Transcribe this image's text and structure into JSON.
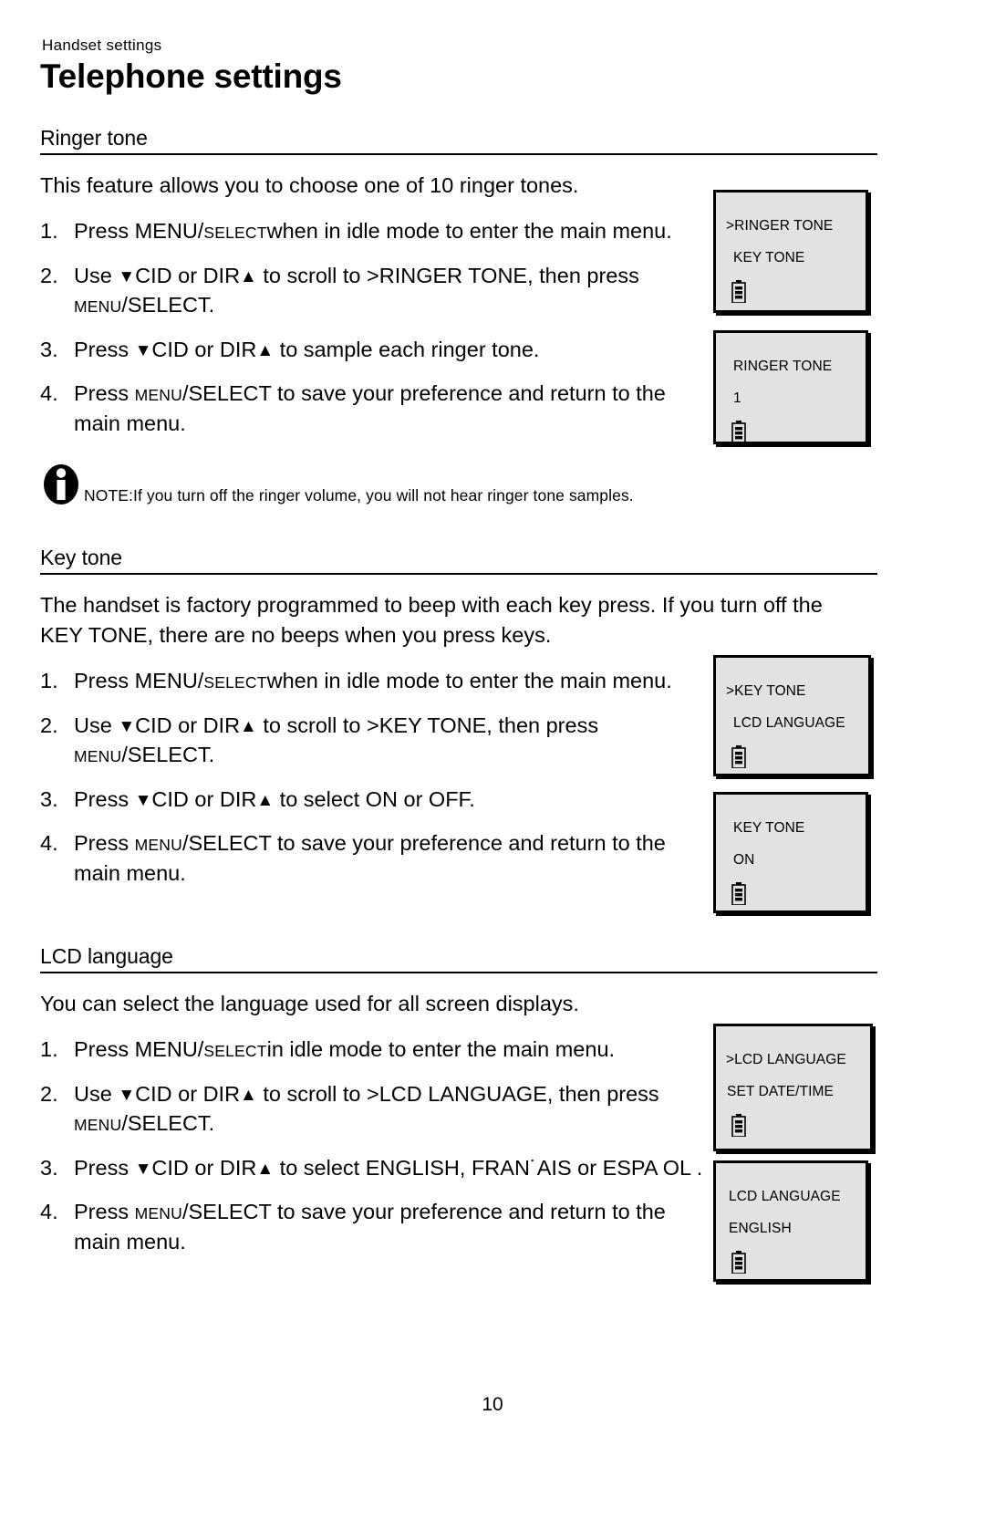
{
  "header": {
    "running_head": "Handset settings",
    "title": "Telephone settings"
  },
  "sections": [
    {
      "id": "ringer-tone",
      "heading": "Ringer tone",
      "intro": "This feature allows you to choose one of 10 ringer tones.",
      "steps": [
        {
          "num": "1.",
          "parts": [
            {
              "t": "Press MENU/",
              "style": "normal"
            },
            {
              "t": "SELECT",
              "style": "smallcaps"
            },
            {
              "t": "when in idle mode to enter the main menu.",
              "style": "normal"
            }
          ]
        },
        {
          "num": "2.",
          "parts": [
            {
              "t": "Use ",
              "style": "normal"
            },
            {
              "t": "▼",
              "style": "arrow"
            },
            {
              "t": "CID or DIR",
              "style": "normal"
            },
            {
              "t": "▲",
              "style": "arrow"
            },
            {
              "t": " to scroll to >RINGER TONE, then press ",
              "style": "normal"
            },
            {
              "t": "MENU",
              "style": "smallcaps"
            },
            {
              "t": "/SELECT.",
              "style": "normal"
            }
          ]
        },
        {
          "num": "3.",
          "parts": [
            {
              "t": "Press ",
              "style": "normal"
            },
            {
              "t": "▼",
              "style": "arrow"
            },
            {
              "t": "CID or DIR",
              "style": "normal"
            },
            {
              "t": "▲",
              "style": "arrow"
            },
            {
              "t": " to sample each ringer tone.",
              "style": "normal"
            }
          ]
        },
        {
          "num": "4.",
          "parts": [
            {
              "t": "Press ",
              "style": "normal"
            },
            {
              "t": "MENU",
              "style": "smallcaps"
            },
            {
              "t": "/SELECT",
              "style": "normal"
            },
            {
              "t": " to save your preference and return to the main menu.",
              "style": "normal"
            }
          ]
        }
      ]
    },
    {
      "id": "key-tone",
      "heading": "Key tone",
      "intro": "The handset is factory programmed to beep with each key press. If you turn off the KEY TONE, there are no beeps when you press keys.",
      "steps": [
        {
          "num": "1.",
          "parts": [
            {
              "t": "Press MENU/",
              "style": "normal"
            },
            {
              "t": "SELECT",
              "style": "smallcaps"
            },
            {
              "t": "when in idle mode to enter the main menu.",
              "style": "normal"
            }
          ]
        },
        {
          "num": "2.",
          "parts": [
            {
              "t": "Use ",
              "style": "normal"
            },
            {
              "t": "▼",
              "style": "arrow"
            },
            {
              "t": "CID or DIR",
              "style": "normal"
            },
            {
              "t": "▲",
              "style": "arrow"
            },
            {
              "t": " to scroll to >KEY TONE, then press ",
              "style": "normal"
            },
            {
              "t": "MENU",
              "style": "smallcaps"
            },
            {
              "t": "/SELECT.",
              "style": "normal"
            }
          ]
        },
        {
          "num": "3.",
          "parts": [
            {
              "t": "Press ",
              "style": "normal"
            },
            {
              "t": "▼",
              "style": "arrow"
            },
            {
              "t": "CID or DIR",
              "style": "normal"
            },
            {
              "t": "▲",
              "style": "arrow"
            },
            {
              "t": " to select ON or OFF.",
              "style": "normal"
            }
          ]
        },
        {
          "num": "4.",
          "parts": [
            {
              "t": "Press ",
              "style": "normal"
            },
            {
              "t": "MENU",
              "style": "smallcaps"
            },
            {
              "t": "/SELECT",
              "style": "normal"
            },
            {
              "t": " to save your preference and return to the main menu.",
              "style": "normal"
            }
          ]
        }
      ]
    },
    {
      "id": "lcd-language",
      "heading": "LCD language",
      "intro": "You can select the language used for all screen displays.",
      "steps": [
        {
          "num": "1.",
          "parts": [
            {
              "t": "Press MENU/",
              "style": "normal"
            },
            {
              "t": "SELECT",
              "style": "smallcaps"
            },
            {
              "t": "in idle mode to enter the main menu.",
              "style": "normal"
            }
          ]
        },
        {
          "num": "2.",
          "parts": [
            {
              "t": "Use ",
              "style": "normal"
            },
            {
              "t": "▼",
              "style": "arrow"
            },
            {
              "t": "CID or DIR",
              "style": "normal"
            },
            {
              "t": "▲",
              "style": "arrow"
            },
            {
              "t": " to scroll to >LCD LANGUAGE, then press ",
              "style": "normal"
            },
            {
              "t": "MENU",
              "style": "smallcaps"
            },
            {
              "t": "/SELECT.",
              "style": "normal"
            }
          ]
        },
        {
          "num": "3.",
          "parts": [
            {
              "t": "Press ",
              "style": "normal"
            },
            {
              "t": "▼",
              "style": "arrow"
            },
            {
              "t": "CID or DIR",
              "style": "normal"
            },
            {
              "t": "▲",
              "style": "arrow"
            },
            {
              "t": " to select ENGLISH, FRAN˙AIS  or ESPA OL .",
              "style": "normal"
            }
          ]
        },
        {
          "num": "4.",
          "parts": [
            {
              "t": "Press ",
              "style": "normal"
            },
            {
              "t": "MENU",
              "style": "smallcaps"
            },
            {
              "t": "/SELECT",
              "style": "normal"
            },
            {
              "t": " to save your preference and return to the main menu.",
              "style": "normal"
            }
          ]
        }
      ]
    }
  ],
  "note": {
    "icon": "info-icon",
    "label": "NOTE:",
    "text": "If you turn off the ringer volume, you will not hear ringer tone samples."
  },
  "lcd_screens": [
    {
      "id": "ringer-tone-menu",
      "line1": ">RINGER TONE",
      "line2": "KEY TONE",
      "battery": "battery-icon"
    },
    {
      "id": "ringer-tone-value",
      "line1": "RINGER TONE",
      "line2": "1",
      "battery": "battery-icon"
    },
    {
      "id": "key-tone-menu",
      "line1": ">KEY TONE",
      "line2": "LCD LANGUAGE",
      "battery": "battery-icon"
    },
    {
      "id": "key-tone-value",
      "line1": "KEY TONE",
      "line2": "ON",
      "battery": "battery-icon"
    },
    {
      "id": "lcd-language-menu",
      "line1": ">LCD LANGUAGE",
      "line2": "SET DATE/TIME",
      "battery": "battery-icon"
    },
    {
      "id": "lcd-language-value",
      "line1": "LCD LANGUAGE",
      "line2": "ENGLISH",
      "battery": "battery-icon"
    }
  ],
  "footer": {
    "page_number": "10"
  },
  "colors": {
    "lcd_background": "#e2e2e2",
    "ink": "#000000",
    "paper": "#ffffff"
  }
}
